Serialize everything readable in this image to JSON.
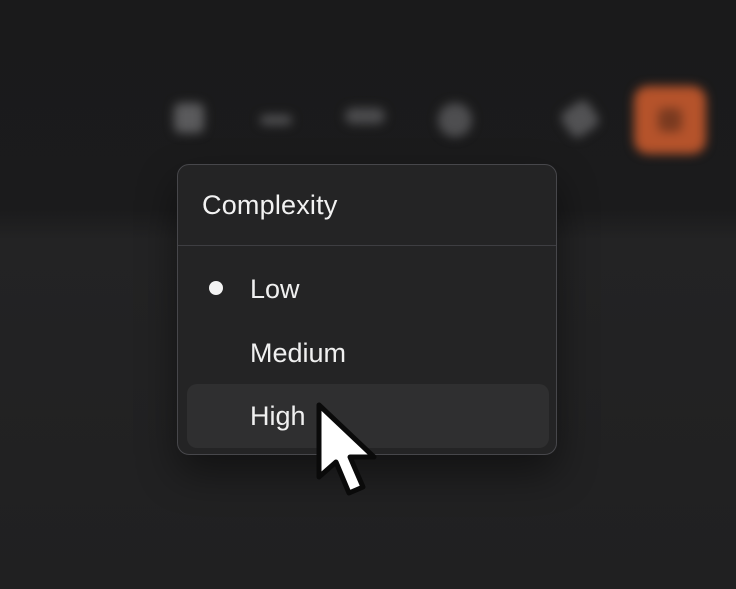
{
  "toolbar": {
    "icons": [
      "grid-icon",
      "more-dots-icon",
      "waveform-icon",
      "target-icon",
      "attachment-icon",
      "accent-action-icon"
    ],
    "accent_color": "#b5532b"
  },
  "menu": {
    "title": "Complexity",
    "options": [
      {
        "label": "Low",
        "selected": true
      },
      {
        "label": "Medium",
        "selected": false
      },
      {
        "label": "High",
        "selected": false,
        "hovered": true
      }
    ]
  },
  "cursor": {
    "icon": "arrow-pointer-icon"
  }
}
